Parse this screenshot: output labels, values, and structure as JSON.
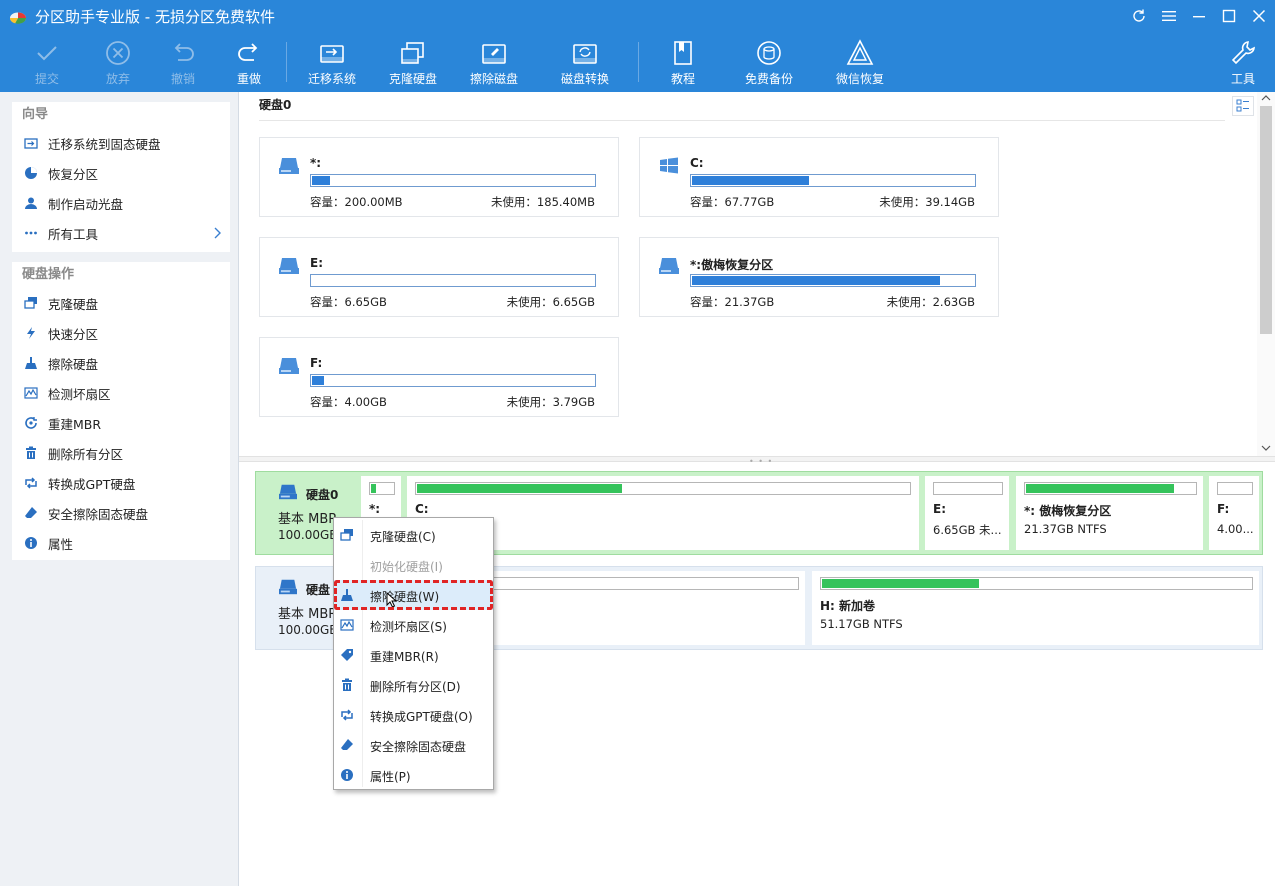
{
  "window": {
    "title": "分区助手专业版 - 无损分区免费软件",
    "controls": [
      "refresh-icon",
      "menu-icon",
      "minimize-icon",
      "maximize-icon",
      "close-icon"
    ]
  },
  "toolbar": {
    "commit": "提交",
    "discard": "放弃",
    "undo": "撤销",
    "redo": "重做",
    "migrate_os": "迁移系统",
    "clone_disk": "克隆硬盘",
    "wipe_disk": "擦除磁盘",
    "disk_convert": "磁盘转换",
    "tutorial": "教程",
    "free_backup": "免费备份",
    "wechat_recovery": "微信恢复",
    "tools": "工具"
  },
  "sidebar": {
    "wizard_title": "向导",
    "wizard_items": [
      {
        "label": "迁移系统到固态硬盘",
        "icon": "migrate-icon"
      },
      {
        "label": "恢复分区",
        "icon": "recover-icon"
      },
      {
        "label": "制作启动光盘",
        "icon": "boot-disc-icon"
      },
      {
        "label": "所有工具",
        "icon": "more-icon"
      }
    ],
    "disk_ops_title": "硬盘操作",
    "disk_ops_items": [
      {
        "label": "克隆硬盘",
        "icon": "clone-icon"
      },
      {
        "label": "快速分区",
        "icon": "lightning-icon"
      },
      {
        "label": "擦除硬盘",
        "icon": "broom-icon"
      },
      {
        "label": "检测坏扇区",
        "icon": "chart-icon"
      },
      {
        "label": "重建MBR",
        "icon": "rebuild-icon"
      },
      {
        "label": "删除所有分区",
        "icon": "trash-icon"
      },
      {
        "label": "转换成GPT硬盘",
        "icon": "convert-icon"
      },
      {
        "label": "安全擦除固态硬盘",
        "icon": "eraser-icon"
      },
      {
        "label": "属性",
        "icon": "info-icon"
      }
    ]
  },
  "disk_panel": {
    "header": "硬盘0",
    "cards": [
      {
        "name": "*:",
        "capacity": "容量：200.00MB",
        "free": "未使用：185.40MB",
        "used_fraction": 0.07,
        "icon": "drive-icon"
      },
      {
        "name": "C:",
        "capacity": "容量：67.77GB",
        "free": "未使用：39.14GB",
        "used_fraction": 0.42,
        "icon": "windows-icon"
      },
      {
        "name": "E:",
        "capacity": "容量：6.65GB",
        "free": "未使用：6.65GB",
        "used_fraction": 0.0,
        "icon": "drive-icon"
      },
      {
        "name": "*:傲梅恢复分区",
        "capacity": "容量：21.37GB",
        "free": "未使用：2.63GB",
        "used_fraction": 0.88,
        "icon": "drive-icon"
      },
      {
        "name": "F:",
        "capacity": "容量：4.00GB",
        "free": "未使用：3.79GB",
        "used_fraction": 0.05,
        "icon": "drive-icon"
      }
    ]
  },
  "disks": [
    {
      "name": "硬盘0",
      "type": "基本 MBR",
      "size": "100.00GB",
      "partitions": [
        {
          "name": "*:",
          "info": "",
          "used_fraction": 0.3
        },
        {
          "name": "C:",
          "info": "",
          "used_fraction": 0.42
        },
        {
          "name": "E:",
          "info": "6.65GB 未...",
          "used_fraction": 0.0
        },
        {
          "name": "*: 傲梅恢复分区",
          "info": "21.37GB NTFS",
          "used_fraction": 0.88
        },
        {
          "name": "F:",
          "info": "4.00...",
          "used_fraction": 0.05
        }
      ]
    },
    {
      "name": "硬盘",
      "type": "基本 MBR",
      "size": "100.00GB",
      "partitions": [
        {
          "name": "",
          "info": "",
          "used_fraction": 0.0
        },
        {
          "name": "H: 新加卷",
          "info": "51.17GB NTFS",
          "used_fraction": 0.37
        }
      ]
    }
  ],
  "context_menu": {
    "items": [
      {
        "label": "克隆硬盘(C)",
        "icon": "clone-icon",
        "enabled": true
      },
      {
        "label": "初始化硬盘(I)",
        "icon": "",
        "enabled": false
      },
      {
        "label": "擦除硬盘(W)",
        "icon": "broom-icon",
        "enabled": true,
        "highlighted": true
      },
      {
        "label": "检测坏扇区(S)",
        "icon": "chart-icon",
        "enabled": true
      },
      {
        "label": "重建MBR(R)",
        "icon": "tag-icon",
        "enabled": true
      },
      {
        "label": "删除所有分区(D)",
        "icon": "trash-icon",
        "enabled": true
      },
      {
        "label": "转换成GPT硬盘(O)",
        "icon": "convert-icon",
        "enabled": true
      },
      {
        "label": "安全擦除固态硬盘",
        "icon": "eraser-icon",
        "enabled": true
      },
      {
        "label": "属性(P)",
        "icon": "info-icon",
        "enabled": true
      }
    ]
  },
  "colors": {
    "toolbar_bg": "#2a86d9",
    "used_bar": "#2e7fd9",
    "partition_bar": "#35c35b",
    "selected_disk_bg": "#c9f1c9",
    "highlight_border": "#e02424"
  }
}
